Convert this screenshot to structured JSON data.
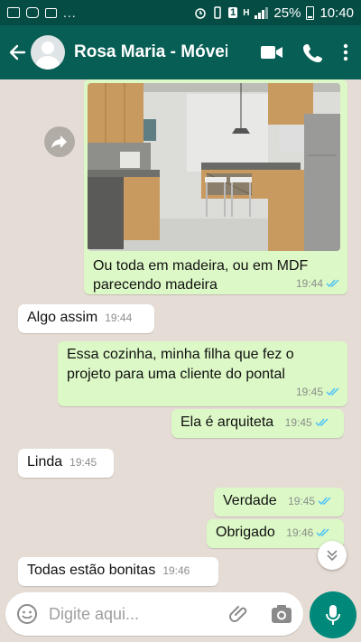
{
  "statusbar": {
    "battery_percent": "25%",
    "time": "10:40",
    "overflow": "...",
    "network": "H",
    "sim": "1"
  },
  "header": {
    "title": "Rosa Maria - Móveis Planejados"
  },
  "messages": {
    "m1": {
      "caption_line1": "Ou toda em madeira, ou em MDF",
      "caption_line2": "parecendo madeira",
      "time": "19:44"
    },
    "m2": {
      "text": "Algo assim",
      "time": "19:44"
    },
    "m3": {
      "line1": "Essa cozinha, minha filha que fez o",
      "line2": "projeto para uma cliente do pontal",
      "time": "19:45"
    },
    "m4": {
      "text": "Ela é arquiteta",
      "time": "19:45"
    },
    "m5": {
      "text": "Linda",
      "time": "19:45"
    },
    "m6": {
      "text": "Verdade",
      "time": "19:45"
    },
    "m7": {
      "text": "Obrigado",
      "time": "19:46"
    },
    "m8": {
      "text": "Todas estão bonitas",
      "time": "19:46"
    }
  },
  "composer": {
    "placeholder": "Digite aqui..."
  },
  "colors": {
    "header": "#075e54",
    "statusbar": "#054d44",
    "outgoing_bubble": "#dcf8c6",
    "incoming_bubble": "#ffffff",
    "chat_background": "#e5ddd5",
    "read_ticks": "#4fc3f7",
    "mic_button": "#00897b"
  },
  "icons": {
    "back": "arrow-left-icon",
    "video": "video-call-icon",
    "call": "phone-icon",
    "menu": "more-vert-icon",
    "emoji": "emoji-icon",
    "attach": "paperclip-icon",
    "camera": "camera-icon",
    "mic": "mic-icon",
    "forward": "forward-icon",
    "scroll": "chevron-double-down-icon"
  }
}
